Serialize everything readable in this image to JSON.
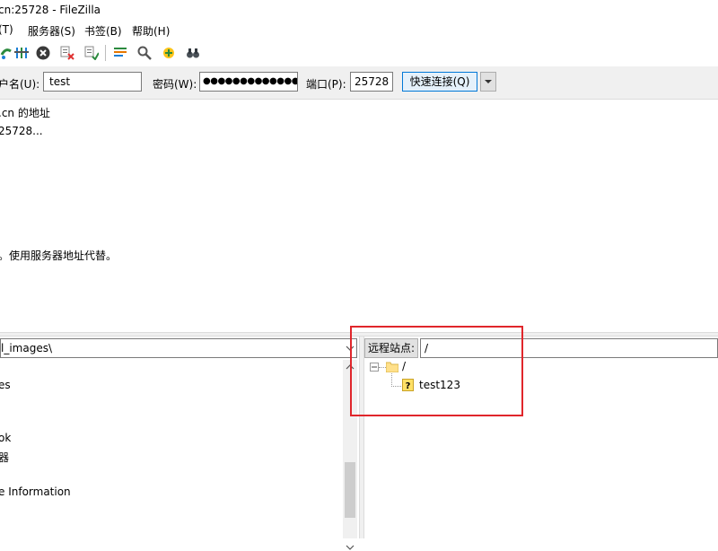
{
  "window": {
    "title": "cn:25728 - FileZilla"
  },
  "menu": {
    "items": [
      "(T)",
      "服务器(S)",
      "书签(B)",
      "帮助(H)"
    ]
  },
  "toolbar": {
    "icons": [
      "refresh-icon",
      "filter-icon",
      "cancel-icon",
      "disconnect-icon",
      "reconnect-icon",
      "directory-listing-icon",
      "search-icon",
      "compare-icon",
      "binoculars-icon"
    ]
  },
  "quickconnect": {
    "user_label": "户名(U):",
    "user_value": "test",
    "password_label": "密码(W):",
    "password_value": "●●●●●●●●●●●●●●",
    "port_label": "端口(P):",
    "port_value": "25728",
    "connect_label": "快速连接(Q)"
  },
  "log": {
    "lines": [
      ".cn 的地址",
      "25728...",
      "。使用服务器地址代替。"
    ]
  },
  "local": {
    "path": "l_images\\",
    "items": [
      "es",
      "ok",
      "器",
      "e Information"
    ]
  },
  "remote": {
    "label": "远程站点:",
    "path": "/",
    "tree_root": "/",
    "tree_child": "test123"
  },
  "colors": {
    "highlight_box": "#e0262b",
    "accent": "#0078d7"
  }
}
